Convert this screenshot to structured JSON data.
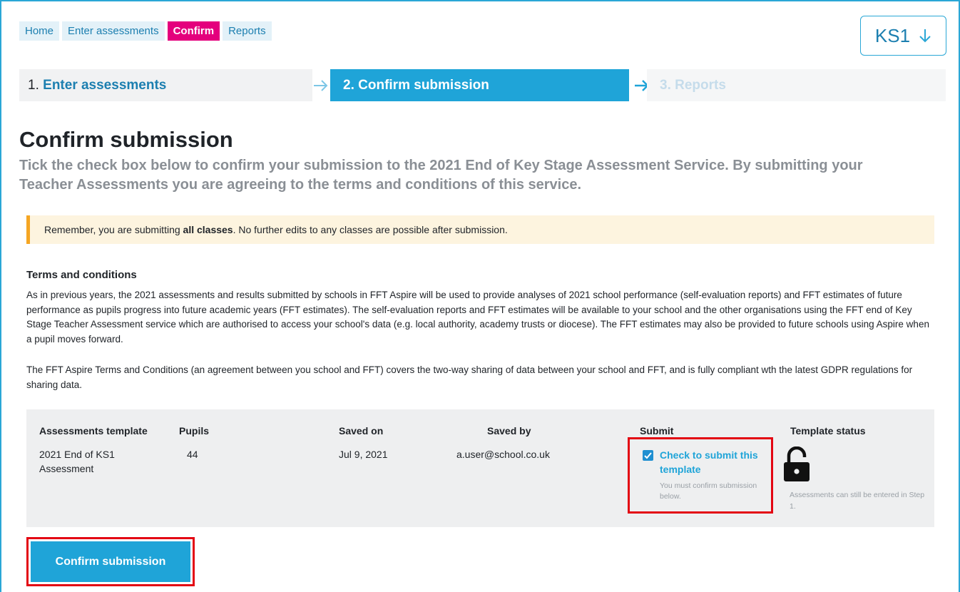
{
  "nav": {
    "tabs": [
      {
        "label": "Home"
      },
      {
        "label": "Enter assessments"
      },
      {
        "label": "Confirm"
      },
      {
        "label": "Reports"
      }
    ],
    "key_stage": "KS1"
  },
  "stepper": {
    "step1": {
      "num": "1.",
      "label": "Enter assessments"
    },
    "step2": {
      "num": "2.",
      "label": "Confirm submission"
    },
    "step3": {
      "num": "3.",
      "label": "Reports"
    }
  },
  "page": {
    "title": "Confirm submission",
    "intro": "Tick the check box below to confirm your submission to the 2021 End of Key Stage Assessment Service. By submitting your Teacher Assessments you are agreeing to the terms and conditions of this service."
  },
  "notice": {
    "pre": "Remember, you are submitting ",
    "bold": "all classes",
    "post": ". No further edits to any classes are possible after submission."
  },
  "terms": {
    "heading": "Terms and conditions",
    "para1": "As in previous years, the 2021 assessments and results submitted by schools in FFT Aspire will be used to provide analyses of 2021 school performance (self-evaluation reports) and FFT estimates of future performance as pupils progress into future academic years (FFT estimates). The self-evaluation reports and FFT estimates will be available to your school and the other organisations using the FFT end of Key Stage Teacher Assessment service which are authorised to access your school's data (e.g. local authority, academy trusts or diocese). The FFT estimates may also be provided to future schools using Aspire when a pupil moves forward.",
    "para2": "The FFT Aspire Terms and Conditions (an agreement between you school and FFT) covers the two-way sharing of data between your school and FFT, and is fully compliant wth the latest GDPR regulations for sharing data."
  },
  "table": {
    "headers": {
      "template": "Assessments template",
      "pupils": "Pupils",
      "saved_on": "Saved on",
      "saved_by": "Saved by",
      "submit": "Submit",
      "status": "Template status"
    },
    "row": {
      "template": "2021 End of KS1 Assessment",
      "pupils": "44",
      "saved_on": "Jul 9, 2021",
      "saved_by": "a.user@school.co.uk",
      "submit_label": "Check to submit this template",
      "submit_checked": true,
      "submit_hint": "You must confirm submission below.",
      "status_text": "Assessments can still be entered in Step 1.",
      "status_icon": "unlocked-padlock-icon"
    }
  },
  "actions": {
    "confirm_label": "Confirm submission"
  },
  "colors": {
    "accent": "#1fa4d8",
    "active_tab": "#e4007d",
    "highlight_box": "#e30613",
    "notice_bar": "#f5a623"
  }
}
